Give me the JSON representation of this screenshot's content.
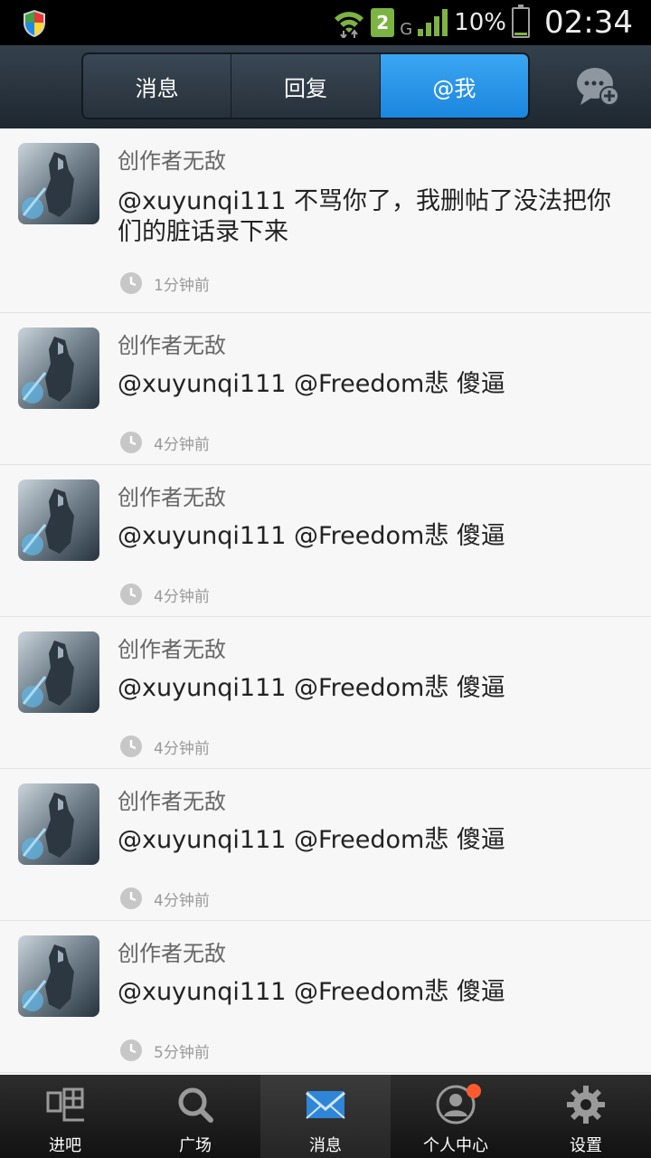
{
  "status_bar": {
    "sim_slot": "2",
    "network": "G",
    "battery": "10%",
    "time": "02:34",
    "battery_level_fraction": 0.1
  },
  "header": {
    "tabs": [
      {
        "label": "消息",
        "active": false
      },
      {
        "label": "回复",
        "active": false
      },
      {
        "label": "@我",
        "active": true
      }
    ],
    "compose_icon": "chat-plus-icon",
    "active_color": "#2196f3"
  },
  "mentions": [
    {
      "user": "创作者无敌",
      "text": "@xuyunqi111  不骂你了，我删帖了没法把你们的脏话录下来",
      "time": "1分钟前"
    },
    {
      "user": "创作者无敌",
      "text": "@xuyunqi111   @Freedom悲  傻逼",
      "time": "4分钟前"
    },
    {
      "user": "创作者无敌",
      "text": "@xuyunqi111   @Freedom悲  傻逼",
      "time": "4分钟前"
    },
    {
      "user": "创作者无敌",
      "text": "@xuyunqi111   @Freedom悲  傻逼",
      "time": "4分钟前"
    },
    {
      "user": "创作者无敌",
      "text": "@xuyunqi111   @Freedom悲  傻逼",
      "time": "4分钟前"
    },
    {
      "user": "创作者无敌",
      "text": "@xuyunqi111   @Freedom悲  傻逼",
      "time": "5分钟前"
    }
  ],
  "bottom_nav": [
    {
      "label": "进吧",
      "icon": "ba-icon",
      "active": false
    },
    {
      "label": "广场",
      "icon": "search-icon",
      "active": false
    },
    {
      "label": "消息",
      "icon": "mail-icon",
      "active": true
    },
    {
      "label": "个人中心",
      "icon": "user-icon",
      "active": false,
      "has_badge": true
    },
    {
      "label": "设置",
      "icon": "gear-icon",
      "active": false
    }
  ],
  "colors": {
    "badge": "#ff5a2e",
    "accent": "#1b86de"
  }
}
